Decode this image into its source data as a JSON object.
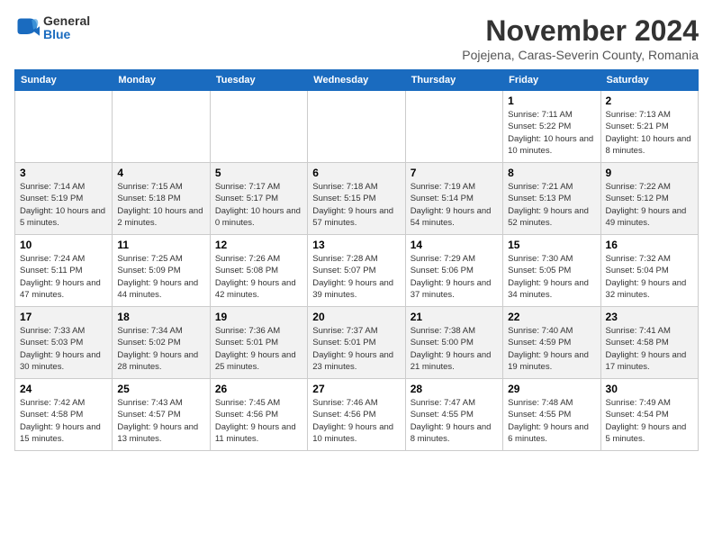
{
  "logo": {
    "general": "General",
    "blue": "Blue"
  },
  "title": "November 2024",
  "subtitle": "Pojejena, Caras-Severin County, Romania",
  "days_of_week": [
    "Sunday",
    "Monday",
    "Tuesday",
    "Wednesday",
    "Thursday",
    "Friday",
    "Saturday"
  ],
  "weeks": [
    [
      {
        "day": "",
        "info": ""
      },
      {
        "day": "",
        "info": ""
      },
      {
        "day": "",
        "info": ""
      },
      {
        "day": "",
        "info": ""
      },
      {
        "day": "",
        "info": ""
      },
      {
        "day": "1",
        "info": "Sunrise: 7:11 AM\nSunset: 5:22 PM\nDaylight: 10 hours and 10 minutes."
      },
      {
        "day": "2",
        "info": "Sunrise: 7:13 AM\nSunset: 5:21 PM\nDaylight: 10 hours and 8 minutes."
      }
    ],
    [
      {
        "day": "3",
        "info": "Sunrise: 7:14 AM\nSunset: 5:19 PM\nDaylight: 10 hours and 5 minutes."
      },
      {
        "day": "4",
        "info": "Sunrise: 7:15 AM\nSunset: 5:18 PM\nDaylight: 10 hours and 2 minutes."
      },
      {
        "day": "5",
        "info": "Sunrise: 7:17 AM\nSunset: 5:17 PM\nDaylight: 10 hours and 0 minutes."
      },
      {
        "day": "6",
        "info": "Sunrise: 7:18 AM\nSunset: 5:15 PM\nDaylight: 9 hours and 57 minutes."
      },
      {
        "day": "7",
        "info": "Sunrise: 7:19 AM\nSunset: 5:14 PM\nDaylight: 9 hours and 54 minutes."
      },
      {
        "day": "8",
        "info": "Sunrise: 7:21 AM\nSunset: 5:13 PM\nDaylight: 9 hours and 52 minutes."
      },
      {
        "day": "9",
        "info": "Sunrise: 7:22 AM\nSunset: 5:12 PM\nDaylight: 9 hours and 49 minutes."
      }
    ],
    [
      {
        "day": "10",
        "info": "Sunrise: 7:24 AM\nSunset: 5:11 PM\nDaylight: 9 hours and 47 minutes."
      },
      {
        "day": "11",
        "info": "Sunrise: 7:25 AM\nSunset: 5:09 PM\nDaylight: 9 hours and 44 minutes."
      },
      {
        "day": "12",
        "info": "Sunrise: 7:26 AM\nSunset: 5:08 PM\nDaylight: 9 hours and 42 minutes."
      },
      {
        "day": "13",
        "info": "Sunrise: 7:28 AM\nSunset: 5:07 PM\nDaylight: 9 hours and 39 minutes."
      },
      {
        "day": "14",
        "info": "Sunrise: 7:29 AM\nSunset: 5:06 PM\nDaylight: 9 hours and 37 minutes."
      },
      {
        "day": "15",
        "info": "Sunrise: 7:30 AM\nSunset: 5:05 PM\nDaylight: 9 hours and 34 minutes."
      },
      {
        "day": "16",
        "info": "Sunrise: 7:32 AM\nSunset: 5:04 PM\nDaylight: 9 hours and 32 minutes."
      }
    ],
    [
      {
        "day": "17",
        "info": "Sunrise: 7:33 AM\nSunset: 5:03 PM\nDaylight: 9 hours and 30 minutes."
      },
      {
        "day": "18",
        "info": "Sunrise: 7:34 AM\nSunset: 5:02 PM\nDaylight: 9 hours and 28 minutes."
      },
      {
        "day": "19",
        "info": "Sunrise: 7:36 AM\nSunset: 5:01 PM\nDaylight: 9 hours and 25 minutes."
      },
      {
        "day": "20",
        "info": "Sunrise: 7:37 AM\nSunset: 5:01 PM\nDaylight: 9 hours and 23 minutes."
      },
      {
        "day": "21",
        "info": "Sunrise: 7:38 AM\nSunset: 5:00 PM\nDaylight: 9 hours and 21 minutes."
      },
      {
        "day": "22",
        "info": "Sunrise: 7:40 AM\nSunset: 4:59 PM\nDaylight: 9 hours and 19 minutes."
      },
      {
        "day": "23",
        "info": "Sunrise: 7:41 AM\nSunset: 4:58 PM\nDaylight: 9 hours and 17 minutes."
      }
    ],
    [
      {
        "day": "24",
        "info": "Sunrise: 7:42 AM\nSunset: 4:58 PM\nDaylight: 9 hours and 15 minutes."
      },
      {
        "day": "25",
        "info": "Sunrise: 7:43 AM\nSunset: 4:57 PM\nDaylight: 9 hours and 13 minutes."
      },
      {
        "day": "26",
        "info": "Sunrise: 7:45 AM\nSunset: 4:56 PM\nDaylight: 9 hours and 11 minutes."
      },
      {
        "day": "27",
        "info": "Sunrise: 7:46 AM\nSunset: 4:56 PM\nDaylight: 9 hours and 10 minutes."
      },
      {
        "day": "28",
        "info": "Sunrise: 7:47 AM\nSunset: 4:55 PM\nDaylight: 9 hours and 8 minutes."
      },
      {
        "day": "29",
        "info": "Sunrise: 7:48 AM\nSunset: 4:55 PM\nDaylight: 9 hours and 6 minutes."
      },
      {
        "day": "30",
        "info": "Sunrise: 7:49 AM\nSunset: 4:54 PM\nDaylight: 9 hours and 5 minutes."
      }
    ]
  ]
}
